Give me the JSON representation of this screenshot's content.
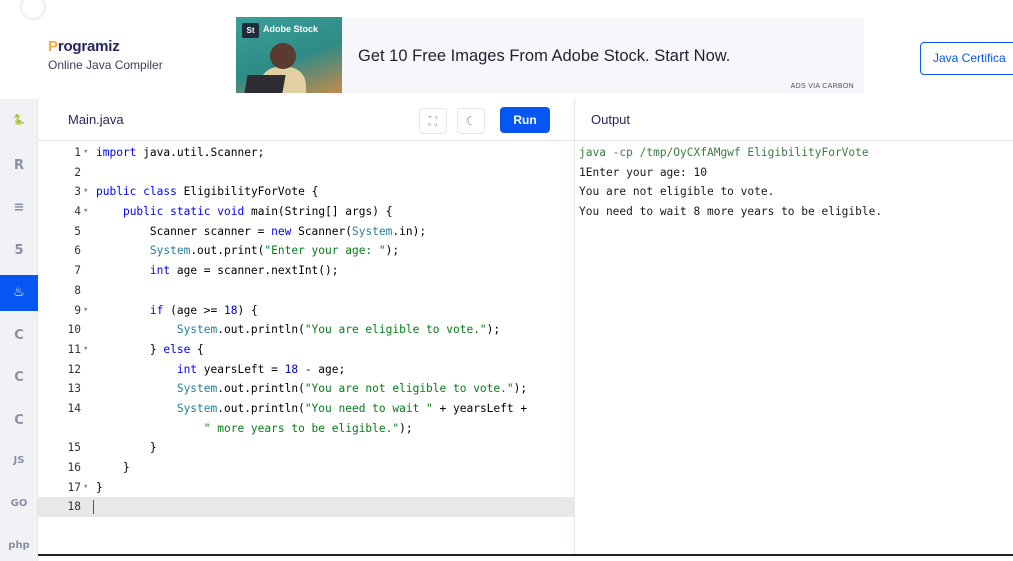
{
  "header": {
    "brand_name": "Programiz",
    "brand_first": "P",
    "brand_rest": "rogramiz",
    "brand_subtitle": "Online Java Compiler",
    "certification_button": "Java Certifica"
  },
  "ad": {
    "brand_label": "Adobe Stock",
    "brand_badge": "St",
    "headline": "Get 10 Free Images From Adobe Stock. Start Now.",
    "via_label": "ADS VIA CARBON"
  },
  "sidebar": {
    "languages": [
      {
        "name": "python",
        "glyph": "🐍",
        "active": false
      },
      {
        "name": "r",
        "glyph": "R",
        "active": false
      },
      {
        "name": "sql",
        "glyph": "≡",
        "active": false
      },
      {
        "name": "html",
        "glyph": "5",
        "active": false
      },
      {
        "name": "java",
        "glyph": "♨",
        "active": true
      },
      {
        "name": "c",
        "glyph": "C",
        "active": false
      },
      {
        "name": "cpp",
        "glyph": "C",
        "active": false
      },
      {
        "name": "csharp",
        "glyph": "C",
        "active": false
      },
      {
        "name": "javascript",
        "glyph": "JS",
        "active": false
      },
      {
        "name": "go",
        "glyph": "GO",
        "active": false
      },
      {
        "name": "php",
        "glyph": "php",
        "active": false
      }
    ]
  },
  "editor": {
    "file_tab": "Main.java",
    "run_label": "Run",
    "icons": [
      "fullscreen-icon",
      "theme-moon-icon"
    ]
  },
  "output": {
    "label": "Output",
    "lines": [
      "java -cp /tmp/OyCXfAMgwf EligibilityForVote",
      "1Enter your age: 10",
      "You are not eligible to vote.",
      "You need to wait 8 more years to be eligible."
    ]
  },
  "code_lines": [
    {
      "n": "1",
      "fold": "▾",
      "text": "import java.util.Scanner;"
    },
    {
      "n": "2",
      "fold": "",
      "text": ""
    },
    {
      "n": "3",
      "fold": "▾",
      "text": "public class EligibilityForVote {"
    },
    {
      "n": "4",
      "fold": "▾",
      "text": "    public static void main(String[] args) {"
    },
    {
      "n": "5",
      "fold": "",
      "text": "        Scanner scanner = new Scanner(System.in);"
    },
    {
      "n": "6",
      "fold": "",
      "text": "        System.out.print(\"Enter your age: \");"
    },
    {
      "n": "7",
      "fold": "",
      "text": "        int age = scanner.nextInt();"
    },
    {
      "n": "8",
      "fold": "",
      "text": ""
    },
    {
      "n": "9",
      "fold": "▾",
      "text": "        if (age >= 18) {"
    },
    {
      "n": "10",
      "fold": "",
      "text": "            System.out.println(\"You are eligible to vote.\");"
    },
    {
      "n": "11",
      "fold": "▾",
      "text": "        } else {"
    },
    {
      "n": "12",
      "fold": "",
      "text": "            int yearsLeft = 18 - age;"
    },
    {
      "n": "13",
      "fold": "",
      "text": "            System.out.println(\"You are not eligible to vote.\");"
    },
    {
      "n": "14",
      "fold": "",
      "text": "            System.out.println(\"You need to wait \" + yearsLeft +"
    },
    {
      "n": "",
      "fold": "",
      "text": "                \" more years to be eligible.\");"
    },
    {
      "n": "15",
      "fold": "",
      "text": "        }"
    },
    {
      "n": "16",
      "fold": "",
      "text": "    }"
    },
    {
      "n": "17",
      "fold": "▾",
      "text": "}"
    },
    {
      "n": "18",
      "fold": "",
      "text": "",
      "active": true
    }
  ],
  "colors": {
    "accent": "#0556f3",
    "brand_orange": "#f2a93b",
    "keyword": "#0000ff",
    "string": "#067d17",
    "output_command": "#3a7d43"
  }
}
